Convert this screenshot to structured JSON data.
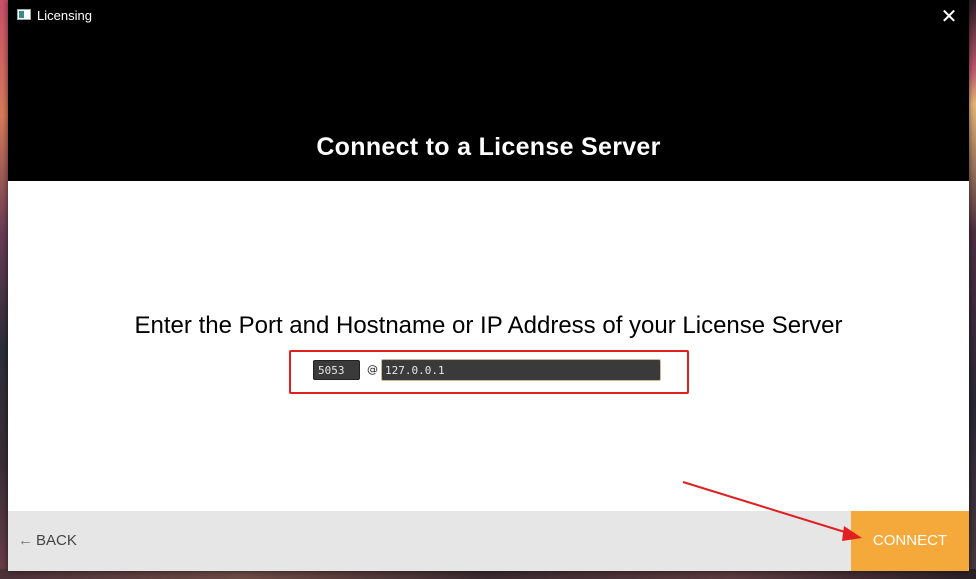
{
  "window": {
    "title": "Licensing",
    "close_glyph": "✕"
  },
  "header": {
    "headline": "Connect to a License Server"
  },
  "main": {
    "instruction": "Enter the Port and Hostname or IP Address of your License Server",
    "port_value": "5053",
    "separator": "@",
    "host_value": "127.0.0.1"
  },
  "footer": {
    "back_arrow": "←",
    "back_label": "BACK",
    "connect_label": "CONNECT"
  },
  "colors": {
    "header_bg": "#000000",
    "accent": "#f4a93a",
    "annotation": "#e02020"
  }
}
